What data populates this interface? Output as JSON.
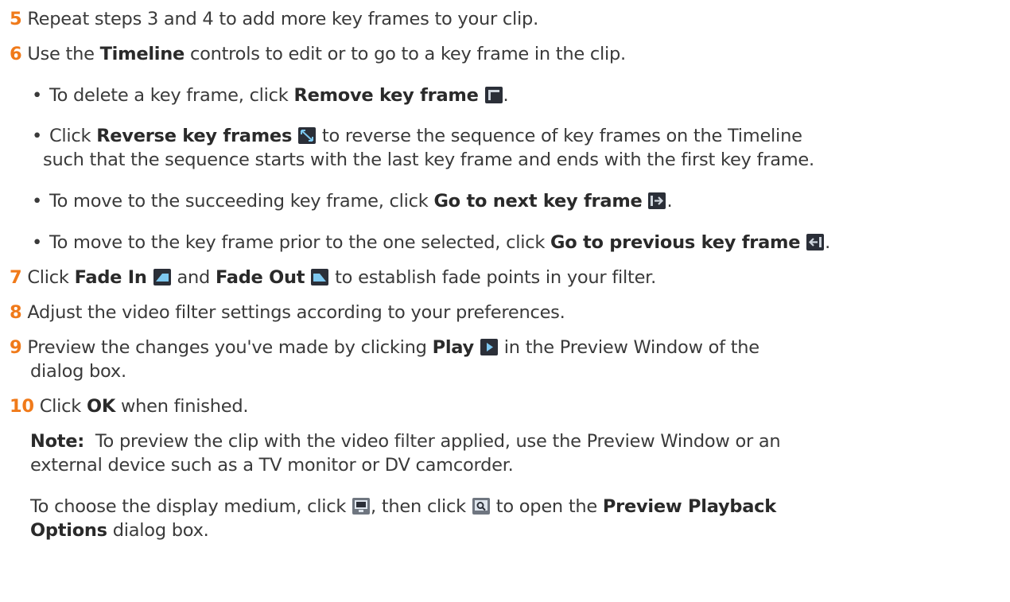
{
  "steps": [
    {
      "num": "5",
      "text": "Repeat steps 3 and 4 to add more key frames to your clip."
    },
    {
      "num": "6",
      "t1": "Use the ",
      "b1": "Timeline",
      "t2": " controls to edit or to go to a key frame in the clip."
    },
    {
      "num": "7",
      "b1": "Fade In",
      "t2": " and ",
      "b2": "Fade Out",
      "t3": " to establish fade points in your filter.",
      "t0": "Click "
    },
    {
      "num": "8",
      "text": "Adjust the video filter settings according to your preferences."
    },
    {
      "num": "9",
      "t1": "Preview the changes you've made by clicking ",
      "b1": "Play",
      "t2": " in the Preview Window of the",
      "cont": "dialog box."
    },
    {
      "num": "10",
      "t1": "Click ",
      "b1": "OK",
      "t2": " when finished."
    }
  ],
  "bullets": {
    "glyph": "•",
    "remove": {
      "t1": "To delete a key frame, click ",
      "b1": "Remove key frame",
      "t2": "."
    },
    "reverse": {
      "t1": "Click ",
      "b1": "Reverse key frames",
      "t2": " to reverse the sequence of key frames on the Timeline",
      "cont": "such that the sequence starts with the last key frame and ends with the first key frame."
    },
    "next": {
      "t1": "To move to the succeeding key frame, click ",
      "b1": "Go to next key frame",
      "t2": "."
    },
    "prev": {
      "t1": "To move to the key frame prior to the one selected, click ",
      "b1": "Go to previous key frame",
      "t2": "."
    }
  },
  "note": {
    "label": "Note:",
    "t1": "  To preview the clip with the video filter applied, use the Preview Window or an",
    "cont": "external device such as a TV monitor or DV camcorder.",
    "p2_t1": "To choose the display medium, click ",
    "p2_t2": ", then click ",
    "p2_t3": " to open the ",
    "p2_b1": "Preview Playback",
    "p2_b2": "Options",
    "p2_t4": " dialog box."
  },
  "icons": {
    "remove": "remove-key-frame-icon",
    "reverse": "reverse-key-frames-icon",
    "next": "next-key-frame-icon",
    "prev": "previous-key-frame-icon",
    "fade_in": "fade-in-icon",
    "fade_out": "fade-out-icon",
    "play": "play-icon",
    "display": "display-medium-icon",
    "preview": "preview-playback-options-icon"
  },
  "colors": {
    "number": "#f07a1a",
    "text": "#3a3a3a",
    "icon_bg": "#2b2f38",
    "icon_accent": "#7ec8f0"
  }
}
